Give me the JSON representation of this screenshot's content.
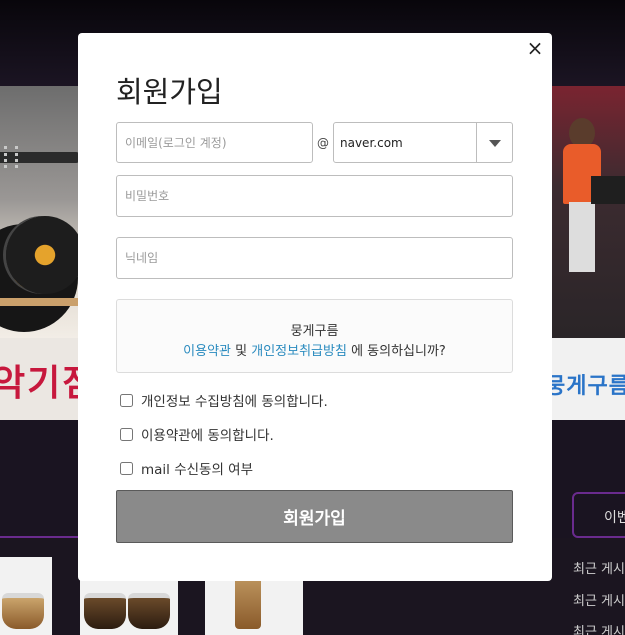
{
  "background": {
    "left_banner_text": "악기점",
    "right_banner_text": "뭉게구름",
    "event_button_label": "이벤",
    "recent_posts": [
      "최근 게시",
      "최근 게시",
      "최근 게시"
    ]
  },
  "modal": {
    "title": "회원가입",
    "close_label": "×",
    "email": {
      "placeholder": "이메일(로그인 계정)",
      "value": ""
    },
    "at_symbol": "@",
    "domain": {
      "selected": "naver.com"
    },
    "password": {
      "placeholder": "비밀번호"
    },
    "nickname": {
      "placeholder": "닉네임"
    },
    "agreement": {
      "site_name": "뭉게구름",
      "terms_link": "이용약관",
      "connector": " 및 ",
      "privacy_link": "개인정보취급방침",
      "question": " 에 동의하십니까?"
    },
    "checkboxes": [
      {
        "label": "개인정보 수집방침에 동의합니다.",
        "checked": false
      },
      {
        "label": "이용약관에 동의합니다.",
        "checked": false
      },
      {
        "label": "mail 수신동의 여부",
        "checked": false
      }
    ],
    "submit_label": "회원가입"
  }
}
